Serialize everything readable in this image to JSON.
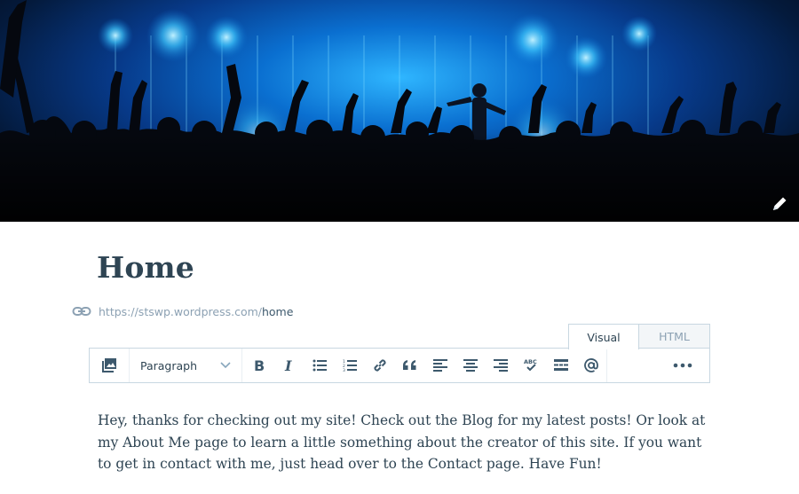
{
  "header": {
    "image_icon": "concert-crowd-image",
    "edit_icon": "pencil-icon"
  },
  "page": {
    "title": "Home",
    "permalink": {
      "icon": "link-icon",
      "base": "https://stswp.wordpress.com/",
      "slug": "home"
    }
  },
  "editor": {
    "tabs": [
      {
        "label": "Visual",
        "active": true
      },
      {
        "label": "HTML",
        "active": false
      }
    ],
    "toolbar": {
      "format_select": "Paragraph",
      "buttons": [
        "add-media",
        "bold",
        "italic",
        "bulleted-list",
        "numbered-list",
        "insert-link",
        "blockquote",
        "align-left",
        "align-center",
        "align-right",
        "spellcheck",
        "read-more",
        "contact-form",
        "more-options"
      ]
    },
    "content": "Hey, thanks for checking out my site! Check out the Blog for my latest posts! Or look at my About Me page to learn a little something about the creator of this site. If you want to get in contact with me, just head over to the Contact page. Have Fun!"
  },
  "colors": {
    "text": "#2e4453",
    "muted": "#8ca1b3",
    "border": "#c8d7e1",
    "stage_blue": "#1ea7ff"
  }
}
